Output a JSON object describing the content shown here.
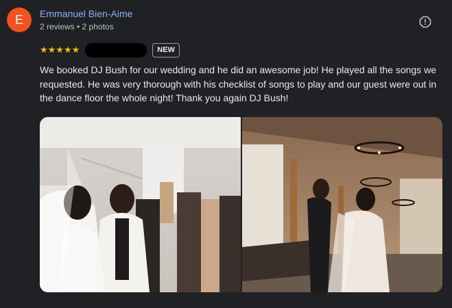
{
  "reviewer": {
    "initial": "E",
    "name": "Emmanuel Bien-Aime",
    "meta": "2 reviews • 2 photos",
    "avatar_color": "#f4511e"
  },
  "review": {
    "stars": "★★★★★",
    "rating": 5,
    "badge": "NEW",
    "text": "We booked DJ Bush for our wedding and he did an awesome job! He played all the songs we requested. He was very thorough with his checklist of songs to play and our guest were out in the dance floor the whole night! Thank you again DJ Bush!"
  },
  "icons": {
    "flag": "report-flag-icon"
  },
  "colors": {
    "background": "#202124",
    "name_link": "#8ab4f8",
    "star": "#fbbc04"
  }
}
